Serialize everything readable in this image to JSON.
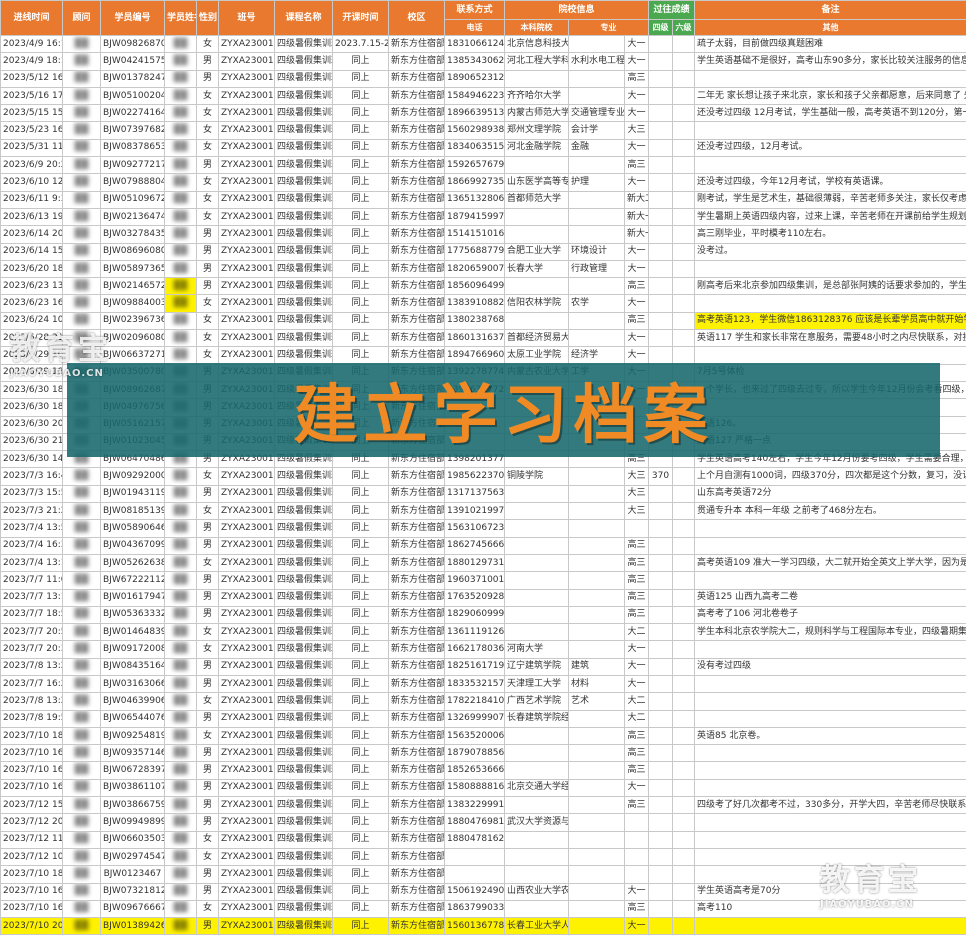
{
  "headers": {
    "top": [
      "进线时间",
      "顾问",
      "学员编号",
      "学员姓名",
      "性别",
      "班号",
      "课程名称",
      "开课时间",
      "校区",
      "联系方式",
      "院校信息",
      "过往成绩",
      "备注"
    ],
    "sub": [
      "电话",
      "本科院校",
      "专业",
      "年级",
      "四级",
      "六级",
      "其他"
    ]
  },
  "rows": [
    [
      "2023/4/9 16:15",
      "BJW09826870022",
      "女",
      "ZYXA23001",
      "四级暑假集训班",
      "2023.7.15-2023.8.1",
      "新东方住宿部",
      "18310661249",
      "北京信息科技大学",
      "",
      "大一",
      "",
      "",
      "疏子太弱，目前做四级真题困难"
    ],
    [
      "2023/4/9 18:15",
      "BJW0424157596",
      "男",
      "ZYXA23001",
      "四级暑假集训班",
      "同上",
      "新东方住宿部",
      "13853430629",
      "河北工程大学科信学院",
      "水利水电工程",
      "大一",
      "",
      "",
      "学生英语基础不是很好，高考山东90多分，家长比较关注服务的信息，尤其在学前后千中年的服务情况"
    ],
    [
      "2023/5/12 16:01",
      "BJW01378247600",
      "男",
      "ZYXA23001",
      "四级暑假集训班",
      "同上",
      "新东方住宿部",
      "18906523121",
      "",
      "",
      "高三",
      "",
      "",
      ""
    ],
    [
      "2023/5/16 17:39",
      "BJW05100204744",
      "女",
      "ZYXA23001",
      "四级暑假集训班",
      "同上",
      "新东方住宿部",
      "15849462239",
      "齐齐哈尔大学",
      "",
      "大一",
      "",
      "",
      "二年无 家长想让孩子来北京，家长和孩子父亲都愿意，后来同意了 先报上 辛苦老师联系安排"
    ],
    [
      "2023/5/15 15:18",
      "BJW02274164229",
      "女",
      "ZYXA23001",
      "四级暑假集训班",
      "同上",
      "新东方住宿部",
      "18966395134",
      "内蒙古师范大学",
      "交通管理专业",
      "大一",
      "",
      "",
      "还没考过四级 12月考试，学生基础一般，高考英语不到120分，第一次独自来北京，希望老师能关心一下"
    ],
    [
      "2023/5/23 16:41",
      "BJW07397682843",
      "女",
      "ZYXA23001",
      "四级暑假集训班",
      "同上",
      "新东方住宿部",
      "15602989387",
      "郑州文理学院",
      "会计学",
      "大三",
      "",
      "",
      ""
    ],
    [
      "2023/5/31 11:58",
      "BJW08378653845",
      "女",
      "ZYXA23001",
      "四级暑假集训班",
      "同上",
      "新东方住宿部",
      "18340635159",
      "河北金融学院",
      "金融",
      "大一",
      "",
      "",
      "还没考过四级，12月考试。"
    ],
    [
      "2023/6/9 20:22",
      "BJW09277217311",
      "男",
      "ZYXA23001",
      "四级暑假集训班",
      "同上",
      "新东方住宿部",
      "15926576793",
      "",
      "",
      "高三",
      "",
      "",
      ""
    ],
    [
      "2023/6/10 12:09",
      "BJW07988804401",
      "女",
      "ZYXA23001",
      "四级暑假集训班",
      "同上",
      "新东方住宿部",
      "18669927353",
      "山东医学高等专科学校",
      "护理",
      "大一",
      "",
      "",
      "还没考过四级，今年12月考试，学校有英语课。"
    ],
    [
      "2023/6/11 9:38",
      "BJW05109672244",
      "女",
      "ZYXA23001",
      "四级暑假集训班",
      "同上",
      "新东方住宿部",
      "13651328060",
      "首都师范大学",
      "",
      "新大二",
      "",
      "",
      "刚考试，学生是艺术生，基础很薄弱，辛苦老师多关注，家长仅考虑暑假补课，上课期间孩子有问题可以联系"
    ],
    [
      "2023/6/13 19:57",
      "BJW02136474245",
      "女",
      "ZYXA23001",
      "四级暑假集训班",
      "同上",
      "新东方住宿部",
      "18794159977",
      "",
      "",
      "新大一",
      "",
      "",
      "学生暑期上英语四级内容，过来上课，辛苦老师在开课前给学生规划四级学习，安排词汇单词打卡，学一些"
    ],
    [
      "2023/6/14 20:41",
      "BJW0327843530",
      "男",
      "ZYXA23001",
      "四级暑假集训班",
      "同上",
      "新东方住宿部",
      "15141510167",
      "",
      "",
      "新大一",
      "",
      "",
      "高三刚毕业，平时模考110左右。"
    ],
    [
      "2023/6/14 15:19",
      "BJW08696080273",
      "男",
      "ZYXA23001",
      "四级暑假集训班",
      "同上",
      "新东方住宿部",
      "17756887791",
      "合肥工业大学",
      "环境设计",
      "大一",
      "",
      "",
      "没考过。"
    ],
    [
      "2023/6/20 18:35",
      "BJW05897365396",
      "男",
      "ZYXA23001",
      "四级暑假集训班",
      "同上",
      "新东方住宿部",
      "18206590078",
      "长春大学",
      "行政管理",
      "大一",
      "",
      "",
      ""
    ],
    [
      "2023/6/23 13:36",
      "BJW02146572977",
      "男",
      "ZYXA23001",
      "四级暑假集训班",
      "同上",
      "新东方住宿部",
      "18560964998",
      "",
      "",
      "高三",
      "",
      "",
      "刚高考后来北京参加四级集训，是总部张阿姨的话要求参加的，学生的成绩较好，辛苦老师对学生多关注学习，有问题及时联系家长。"
    ],
    [
      "2023/6/23 16:19",
      "BJW09884003092",
      "女",
      "ZYXA23001",
      "四级暑假集训班",
      "同上",
      "新东方住宿部",
      "13839108822",
      "信阳农林学院",
      "农学",
      "大一",
      "",
      "",
      ""
    ],
    [
      "2023/6/24 10:06",
      "BJW0239673651",
      "女",
      "ZYXA23001",
      "四级暑假集训班",
      "同上",
      "新东方住宿部",
      "13802387688",
      "",
      "",
      "高三",
      "",
      "",
      "高考英语123，学生微信1863128376 应该是长辈学员高中就开始学"
    ],
    [
      "2023/6/28 21:11",
      "BJW02096080647",
      "女",
      "ZYXA23001",
      "四级暑假集训班",
      "同上",
      "新东方住宿部",
      "18601316378",
      "首都经济贸易大学",
      "",
      "大一",
      "",
      "",
      "英语117 学生和家长非常在意服务，需要48小时之内尽快联系，对接并且后面的单词筛选打卡，监督完成单词"
    ],
    [
      "2023/6/29 10:21",
      "BJW06637271384",
      "女",
      "ZYXA23001",
      "四级暑假集训班",
      "同上",
      "新东方住宿部",
      "18947669608",
      "太原工业学院",
      "经济学",
      "大一",
      "",
      "",
      ""
    ],
    [
      "2023/6/29 18:05",
      "BJW03500780360",
      "男",
      "ZYXA23001",
      "四级暑假集训班",
      "同上",
      "新东方住宿部",
      "13922787748",
      "内蒙古农业大学",
      "工学",
      "大一",
      "",
      "",
      "7月5号体检"
    ],
    [
      "2023/6/30 18:05",
      "BJW08962687782",
      "男",
      "ZYXA23001",
      "四级暑假集训班",
      "同上",
      "新东方住宿部",
      "13966327722",
      "",
      "",
      "大一",
      "",
      "",
      "一个学长，也来过了四级去过专，所以学生今年12月份会考看四级，这期间上需要参加，家中有需要转到这边来学习英语"
    ],
    [
      "2023/6/30 18:05",
      "BJW04976756663",
      "男",
      "ZYXA23001",
      "四级暑假集训班",
      "同上",
      "新东方住宿部",
      "",
      "",
      "",
      "",
      "",
      "",
      ""
    ],
    [
      "2023/6/30 20:49",
      "BJW05162157841",
      "男",
      "ZYXA23001",
      "四级暑假集训班",
      "同上",
      "新东方住宿部",
      "",
      "",
      "",
      "",
      "",
      "",
      "英语126。"
    ],
    [
      "2023/6/30 21:50",
      "BJW01023045088",
      "男",
      "ZYXA23001",
      "四级暑假集训班",
      "同上",
      "新东方住宿部",
      "",
      "",
      "",
      "",
      "",
      "",
      "英语127 严格一点"
    ],
    [
      "2023/6/30 14:16",
      "BJW0647048631",
      "男",
      "ZYXA23001",
      "四级暑假集训班",
      "同上",
      "新东方住宿部",
      "13982013777",
      "",
      "",
      "高三",
      "",
      "",
      "学生英语高考140左右，学生今年12月份要考四级，学生需要合理，希望能同时安排合适学生，学生自己想过来。希望老师多关注"
    ],
    [
      "2023/7/3 16:43",
      "BJW0929200005",
      "女",
      "ZYXA23001",
      "四级暑假集训班",
      "同上",
      "新东方住宿部",
      "19856223707",
      "铜陵学院",
      "",
      "大三",
      "370",
      "",
      "上个月自测有1000词，四级370分，四次都是这个分数，复习，没认真背，没认真背，希望能帮助"
    ],
    [
      "2023/7/3 15:57",
      "BJW01943119835",
      "男",
      "ZYXA23001",
      "四级暑假集训班",
      "同上",
      "新东方住宿部",
      "13171375637",
      "",
      "",
      "大三",
      "",
      "",
      "山东高考英语72分"
    ],
    [
      "2023/7/3 21:22",
      "BJW08185139657",
      "女",
      "ZYXA23001",
      "四级暑假集训班",
      "同上",
      "新东方住宿部",
      "13910219973",
      "",
      "",
      "大三",
      "",
      "",
      "贯通专升本 本科一年级 之前考了468分左右。"
    ],
    [
      "2023/7/4 13:57",
      "BJW0589064637",
      "男",
      "ZYXA23001",
      "四级暑假集训班",
      "同上",
      "新东方住宿部",
      "15631067231",
      "",
      "",
      "",
      "",
      "",
      ""
    ],
    [
      "2023/7/4 16:34",
      "BJW04367099062",
      "男",
      "ZYXA23001",
      "四级暑假集训班",
      "同上",
      "新东方住宿部",
      "18627456666",
      "",
      "",
      "高三",
      "",
      "",
      ""
    ],
    [
      "2023/7/4 13:15",
      "BJW05262638412",
      "女",
      "ZYXA23001",
      "四级暑假集训班",
      "同上",
      "新东方住宿部",
      "18801297310",
      "",
      "",
      "高三",
      "",
      "",
      "高考英语109 准大一学习四级，大二就开始全英文上学大学，因为是中外合办 的学校大学"
    ],
    [
      "2023/7/7 11:00",
      "BJW672221120054203",
      "男",
      "ZYXA23001",
      "四级暑假集训班",
      "同上",
      "新东方住宿部",
      "19603710016",
      "",
      "",
      "高三",
      "",
      "",
      ""
    ],
    [
      "2023/7/7 13:10",
      "BJW01617947738",
      "男",
      "ZYXA23001",
      "四级暑假集训班",
      "同上",
      "新东方住宿部",
      "17635209286",
      "",
      "",
      "高三",
      "",
      "",
      "英语125 山西九高考二卷"
    ],
    [
      "2023/7/7 18:57",
      "BJW05363332657",
      "男",
      "ZYXA23001",
      "四级暑假集训班",
      "同上",
      "新东方住宿部",
      "18290609999",
      "",
      "",
      "高三",
      "",
      "",
      "高考考了106 河北卷卷子"
    ],
    [
      "2023/7/7 20:56",
      "BJW01464839696",
      "女",
      "ZYXA23001",
      "四级暑假集训班",
      "同上",
      "新东方住宿部",
      "13611191266",
      "",
      "",
      "大二",
      "",
      "",
      "学生本科北京农学院大二，规则科学与工程国际本专业，四级暑期集训 英语数学大二补大二"
    ],
    [
      "2023/7/7 20:39",
      "BJW09172008667",
      "女",
      "ZYXA23001",
      "四级暑假集训班",
      "同上",
      "新东方住宿部",
      "16621780362",
      "河南大学",
      "",
      "大一",
      "",
      "",
      ""
    ],
    [
      "2023/7/8 13:24",
      "BJW08435164662",
      "男",
      "ZYXA23001",
      "四级暑假集训班",
      "同上",
      "新东方住宿部",
      "18251617197利斯",
      "辽宁建筑学院",
      "建筑",
      "大一",
      "",
      "",
      "没有考过四级"
    ],
    [
      "2023/7/7 16:23",
      "BJW03163066395",
      "男",
      "ZYXA23001",
      "四级暑假集训班",
      "同上",
      "新东方住宿部",
      "18335321577",
      "天津理工大学",
      "材料",
      "大一",
      "",
      "",
      ""
    ],
    [
      "2023/7/8 13:27",
      "BJW04639906566",
      "女",
      "ZYXA23001",
      "四级暑假集训班",
      "同上",
      "新东方住宿部",
      "17822184107",
      "广西艺术学院",
      "艺术",
      "大二",
      "",
      "",
      ""
    ],
    [
      "2023/7/8 19:55",
      "BJW06544076648",
      "男",
      "ZYXA23001",
      "四级暑假集训班",
      "同上",
      "新东方住宿部",
      "13269999079",
      "长春建筑学院经济管理 工商管理",
      "",
      "大二",
      "",
      "",
      ""
    ],
    [
      "2023/7/10 18:24",
      "BJW09254819942",
      "女",
      "ZYXA23001",
      "四级暑假集训班",
      "同上",
      "新东方住宿部",
      "15635200066",
      "",
      "",
      "高三",
      "",
      "",
      "英语85 北京卷。"
    ],
    [
      "2023/7/10 16:42",
      "BJW09357146546",
      "男",
      "ZYXA23001",
      "四级暑假集训班",
      "同上",
      "新东方住宿部",
      "18790788566",
      "",
      "",
      "高三",
      "",
      "",
      ""
    ],
    [
      "2023/7/10 16:42",
      "BJW06728397205",
      "男",
      "ZYXA23001",
      "四级暑假集训班",
      "同上",
      "新东方住宿部",
      "18526536669",
      "",
      "",
      "高三",
      "",
      "",
      ""
    ],
    [
      "2023/7/10 16:36",
      "BJW03861107480",
      "男",
      "ZYXA23001",
      "四级暑假集训班",
      "同上",
      "新东方住宿部",
      "15808888168",
      "北京交通大学经济管理",
      "",
      "大一",
      "",
      "",
      ""
    ],
    [
      "2023/7/12 15:06",
      "BJW03866759002",
      "男",
      "ZYXA23001",
      "四级暑假集训班",
      "同上",
      "新东方住宿部",
      "13832299912",
      "",
      "",
      "高三",
      "",
      "",
      "四级考了好几次都考不过，330多分，开学大四，辛苦老师尽快联系。"
    ],
    [
      "2023/7/12 20:31",
      "BJW0994989981",
      "男",
      "ZYXA23001",
      "四级暑假集训班",
      "同上",
      "新东方住宿部",
      "18804769819",
      "武汉大学资源与环境科学学院所",
      "",
      "",
      "",
      "",
      ""
    ],
    [
      "2023/7/12 11:35",
      "BJW06603503644",
      "女",
      "ZYXA23001",
      "四级暑假集训班",
      "同上",
      "新东方住宿部",
      "18804781620",
      "",
      "",
      "",
      "",
      "",
      ""
    ],
    [
      "2023/7/12 10:49",
      "BJW02974547776",
      "女",
      "ZYXA23001",
      "四级暑假集训班",
      "同上",
      "新东方住宿部",
      "",
      "",
      "",
      "",
      "",
      "",
      ""
    ],
    [
      "2023/7/10 18:25",
      "BJW0123467",
      "男",
      "ZYXA23001",
      "四级暑假集训班",
      "同上",
      "新东方住宿部",
      "",
      "",
      "",
      "",
      "",
      "",
      ""
    ],
    [
      "2023/7/10 16:33",
      "BJW07321812543",
      "男",
      "ZYXA23001",
      "四级暑假集训班",
      "同上",
      "新东方住宿部",
      "15061924900",
      "山西农业大学农业经济管理 农村区域发展",
      "",
      "大一",
      "",
      "",
      "学生英语高考是70分"
    ],
    [
      "2023/7/10 16:52",
      "BJW09676667587",
      "女",
      "ZYXA23001",
      "四级暑假集训班",
      "同上",
      "新东方住宿部",
      "18637990333",
      "",
      "",
      "高三",
      "",
      "",
      "高考110"
    ],
    [
      "2023/7/10 20:13",
      "BJW01389426692",
      "男",
      "ZYXA23001",
      "四级暑假集训班",
      "同上",
      "新东方住宿部",
      "15601367780",
      "长春工业大学人文信息学院建筑工程学院",
      "",
      "大一",
      "",
      "",
      ""
    ]
  ],
  "banner_text": "建立学习档案",
  "watermark": {
    "brand": "教育宝",
    "domain": "JIAOYUBAO.CN"
  },
  "colors": {
    "header": "#e8792e",
    "header_green": "#4aa84e",
    "highlight": "#fff200",
    "banner": "#16686c",
    "banner_text": "#f08a24"
  }
}
